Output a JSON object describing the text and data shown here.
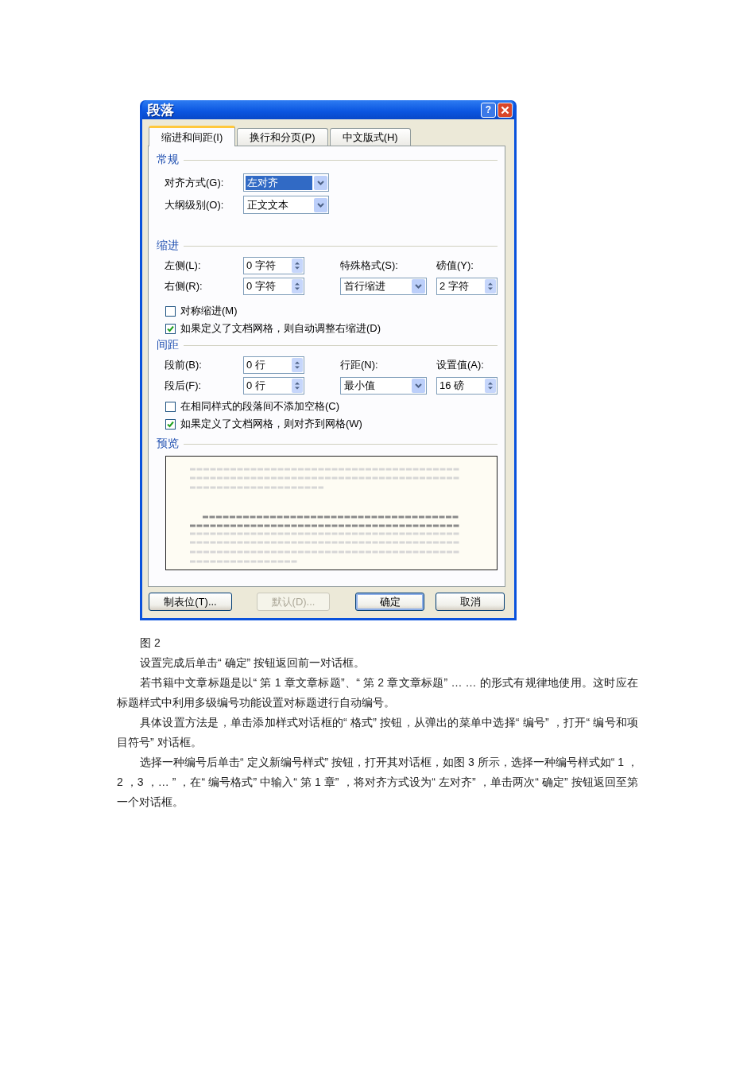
{
  "dialog": {
    "title": "段落",
    "help": "?"
  },
  "tabs": [
    {
      "label": "缩进和间距(I)",
      "selected": true
    },
    {
      "label": "换行和分页(P)",
      "selected": false
    },
    {
      "label": "中文版式(H)",
      "selected": false
    }
  ],
  "general": {
    "title": "常规",
    "fields": [
      {
        "label": "对齐方式(G):",
        "value": "左对齐",
        "focused": true
      },
      {
        "label": "大纲级别(O):",
        "value": "正文文本",
        "focused": false
      }
    ]
  },
  "indent": {
    "title": "缩进",
    "left": {
      "label": "左侧(L):",
      "value": "0 字符"
    },
    "right": {
      "label": "右侧(R):",
      "value": "0 字符"
    },
    "special": {
      "label": "特殊格式(S):",
      "value": "首行缩进"
    },
    "by": {
      "label": "磅值(Y):",
      "value": "2 字符"
    },
    "options": [
      {
        "label": "对称缩进(M)",
        "checked": false
      },
      {
        "label": "如果定义了文档网格，则自动调整右缩进(D)",
        "checked": true
      }
    ]
  },
  "spacing": {
    "title": "间距",
    "before": {
      "label": "段前(B):",
      "value": "0 行"
    },
    "after": {
      "label": "段后(F):",
      "value": "0 行"
    },
    "line_spacing": {
      "label": "行距(N):",
      "value": "最小值"
    },
    "at": {
      "label": "设置值(A):",
      "value": "16 磅"
    },
    "options": [
      {
        "label": "在相同样式的段落间不添加空格(C)",
        "checked": false
      },
      {
        "label": "如果定义了文档网格，则对齐到网格(W)",
        "checked": true
      }
    ]
  },
  "preview": {
    "title": "预览"
  },
  "buttons": [
    {
      "label": "制表位(T)...",
      "default": false,
      "disabled": false
    },
    {
      "label": "默认(D)...",
      "default": false,
      "disabled": true
    },
    {
      "label": "确定",
      "default": true,
      "disabled": false
    },
    {
      "label": "取消",
      "default": false,
      "disabled": false
    }
  ],
  "caption": "图 2",
  "paragraphs": [
    "设置完成后单击“ 确定” 按钮返回前一对话框。",
    "若书籍中文章标题是以“ 第 1 章文章标题”、“ 第 2 章文章标题” … … 的形式有规律地使用。这时应在标题样式中利用多级编号功能设置对标题进行自动编号。",
    "具体设置方法是，单击添加样式对话框的“ 格式” 按钮，从弹出的菜单中选择“ 编号” ，打开“ 编号和项目符号” 对话框。",
    "选择一种编号后单击“ 定义新编号样式” 按钮，打开其对话框，如图 3 所示，选择一种编号样式如“ 1 ，2 ，3 ，… ” ，在“ 编号格式” 中输入“ 第 1 章” ，将对齐方式设为“ 左对齐” ，单击两次“ 确定” 按钮返回至第一个对话框。"
  ]
}
